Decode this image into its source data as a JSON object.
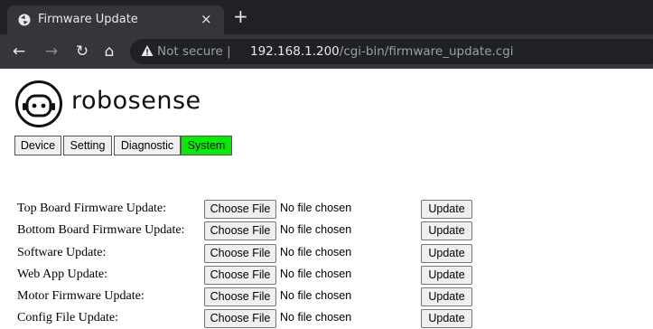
{
  "browser": {
    "tab_title": "Firmware Update",
    "tab_close_glyph": "×",
    "new_tab_glyph": "+",
    "security_label": "Not secure",
    "url_host": "192.168.1.200",
    "url_path": "/cgi-bin/firmware_update.cgi",
    "icons": [
      "favicon-icon",
      "back-icon",
      "forward-icon",
      "reload-icon",
      "home-icon",
      "warning-icon"
    ]
  },
  "brand": {
    "name": "robosense"
  },
  "nav": {
    "tabs": [
      {
        "label": "Device",
        "active": false
      },
      {
        "label": "Setting",
        "active": false
      },
      {
        "label": "Diagnostic",
        "active": false
      },
      {
        "label": "System",
        "active": true
      }
    ],
    "active_color": "#00ee00"
  },
  "updates": {
    "choose_label": "Choose File",
    "no_file_text": "No file chosen",
    "update_label": "Update",
    "rows": [
      {
        "label": "Top Board Firmware Update:"
      },
      {
        "label": "Bottom Board Firmware Update:"
      },
      {
        "label": "Software Update:"
      },
      {
        "label": "Web App Update:"
      },
      {
        "label": "Motor Firmware Update:"
      },
      {
        "label": "Config File Update:"
      }
    ]
  }
}
